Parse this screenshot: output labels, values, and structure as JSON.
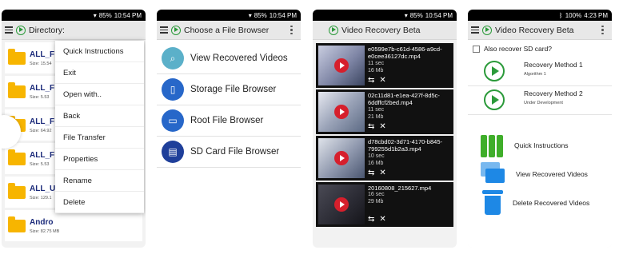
{
  "colors": {
    "accent_green": "#2b9a3a",
    "folder_yellow": "#f7b500",
    "brand_blue": "#2767c9",
    "record_red": "#d61f2c"
  },
  "phone1": {
    "status": {
      "signal": "85%",
      "time": "10:54 PM"
    },
    "title": "Directory:",
    "folders": [
      {
        "name": "ALL_F",
        "size": "Size: 15.54"
      },
      {
        "name": "ALL_F",
        "size": "Size: 5.53"
      },
      {
        "name": "ALL_F",
        "size": "Size: 64.92"
      },
      {
        "name": "ALL_F",
        "size": "Size: 5.53"
      },
      {
        "name": "ALL_U",
        "size": "Size: 129.1"
      },
      {
        "name": "Andro",
        "size": "Size: 82.75 MB"
      }
    ],
    "menu": [
      "Quick Instructions",
      "Exit",
      "Open with..",
      "Back",
      "File Transfer",
      "Properties",
      "Rename",
      "Delete"
    ]
  },
  "phone2": {
    "status": {
      "signal": "85%",
      "time": "10:54 PM"
    },
    "title": "Choose a File Browser",
    "items": [
      {
        "label": "View Recovered Videos",
        "icon": "search-icon"
      },
      {
        "label": "Storage File Browser",
        "icon": "phone-icon"
      },
      {
        "label": "Root File Browser",
        "icon": "folder-icon"
      },
      {
        "label": "SD Card File Browser",
        "icon": "sd-card-icon"
      }
    ]
  },
  "phone3": {
    "status": {
      "signal": "85%",
      "time": "10:54 PM"
    },
    "title": "Video Recovery Beta",
    "videos": [
      {
        "name": "e0599e7b-c61d-4586-a9cd-e0cee36127dc.mp4",
        "duration": "11 sec",
        "size": "16 Mb"
      },
      {
        "name": "02c11d81-e1ea-427f-8d5c-6ddffcf2bed.mp4",
        "duration": "11 sec",
        "size": "21 Mb"
      },
      {
        "name": "d78cbd02-3d71-4170-b845-799255d1b2a3.mp4",
        "duration": "10 sec",
        "size": "16 Mb"
      },
      {
        "name": "20160808_215627.mp4",
        "duration": "16 sec",
        "size": "29 Mb"
      }
    ]
  },
  "phone4": {
    "status": {
      "signal": "100%",
      "time": "4:23 PM"
    },
    "title": "Video Recovery Beta",
    "sd_checkbox": "Also recover SD card?",
    "methods": [
      {
        "title": "Recovery Method 1",
        "subtitle": "Algorithm 1"
      },
      {
        "title": "Recovery Method 2",
        "subtitle": "Under Development"
      }
    ],
    "actions": [
      {
        "label": "Quick Instructions",
        "icon": "books-icon"
      },
      {
        "label": "View Recovered Videos",
        "icon": "folders-icon"
      },
      {
        "label": "Delete Recovered Videos",
        "icon": "trash-icon"
      }
    ]
  }
}
